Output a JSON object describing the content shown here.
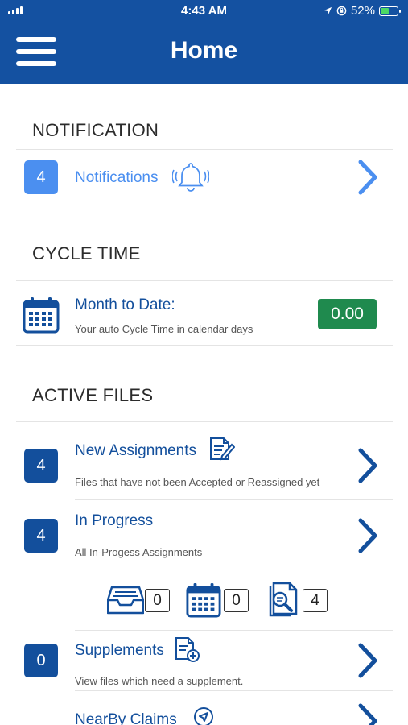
{
  "status_bar": {
    "time": "4:43 AM",
    "battery": "52%",
    "battery_level": 0.52,
    "icons": [
      "signal-icon",
      "location-icon",
      "orientation-lock-icon",
      "battery-charging-icon"
    ]
  },
  "header": {
    "title": "Home",
    "background_color": "#1451a1",
    "menu_icon": "hamburger-menu-icon"
  },
  "notification": {
    "section_title": "NOTIFICATION",
    "count": "4",
    "label": "Notifications",
    "icon": "bell-icon"
  },
  "cycle_time": {
    "section_title": "CYCLE TIME",
    "icon": "calendar-icon",
    "title": "Month to Date:",
    "subtitle": "Your auto Cycle Time in calendar days",
    "value": "0.00",
    "value_color": "#1f8a4e"
  },
  "active_files": {
    "section_title": "ACTIVE FILES",
    "new_assignments": {
      "count": "4",
      "title": "New Assignments",
      "subtitle": "Files that have not been Accepted or Reassigned yet",
      "icon": "document-edit-icon"
    },
    "in_progress": {
      "count": "4",
      "title": "In Progress",
      "subtitle": "All In-Progess Assignments",
      "stats": [
        {
          "icon": "inbox-icon",
          "value": "0"
        },
        {
          "icon": "calendar-icon",
          "value": "0"
        },
        {
          "icon": "document-search-icon",
          "value": "4"
        }
      ]
    },
    "supplements": {
      "count": "0",
      "title": "Supplements",
      "subtitle": "View files which need a supplement.",
      "icon": "document-add-icon"
    },
    "nearby_claims": {
      "title": "NearBy Claims",
      "icon": "navigation-icon"
    }
  },
  "colors": {
    "primary": "#134f9c",
    "accent_light": "#4b8ff0",
    "success": "#1f8a4e"
  }
}
